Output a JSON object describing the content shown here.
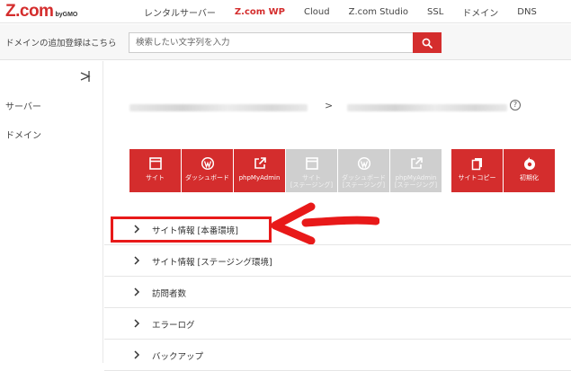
{
  "brand": {
    "logo_main": "Z.com",
    "logo_sub": "byGMO"
  },
  "nav": {
    "items": [
      {
        "label": "レンタルサーバー",
        "active": false
      },
      {
        "label": "Z.com WP",
        "active": true
      },
      {
        "label": "Cloud",
        "active": false
      },
      {
        "label": "Z.com Studio",
        "active": false
      },
      {
        "label": "SSL",
        "active": false
      },
      {
        "label": "ドメイン",
        "active": false
      },
      {
        "label": "DNS",
        "active": false
      }
    ]
  },
  "search": {
    "label": "ドメインの追加登録はこちら",
    "placeholder": "検索したい文字列を入力",
    "value": "",
    "button_icon": "search-icon"
  },
  "sidebar": {
    "collapse_icon": "collapse-icon",
    "items": [
      {
        "label": "サーバー"
      },
      {
        "label": "ドメイン"
      }
    ]
  },
  "breadcrumb": {
    "separator": ">",
    "help": "?"
  },
  "toolbar": {
    "buttons": [
      {
        "label": "サイト",
        "icon": "window-icon",
        "style": "red"
      },
      {
        "label": "ダッシュボード",
        "icon": "wordpress-icon",
        "style": "red"
      },
      {
        "label": "phpMyAdmin",
        "icon": "external-link-icon",
        "style": "red"
      },
      {
        "label": "サイト\n[ステージング]",
        "icon": "window-icon",
        "style": "grey"
      },
      {
        "label": "ダッシュボード\n[ステージング]",
        "icon": "wordpress-icon",
        "style": "grey"
      },
      {
        "label": "phpMyAdmin\n[ステージング]",
        "icon": "external-link-icon",
        "style": "grey"
      },
      {
        "label": "サイトコピー",
        "icon": "copy-icon",
        "style": "red"
      },
      {
        "label": "初期化",
        "icon": "reset-icon",
        "style": "red"
      }
    ]
  },
  "sections": [
    {
      "label": "サイト情報 [本番環境]"
    },
    {
      "label": "サイト情報 [ステージング環境]"
    },
    {
      "label": "訪問者数"
    },
    {
      "label": "エラーログ"
    },
    {
      "label": "バックアップ"
    }
  ],
  "colors": {
    "accent": "#d42d2d",
    "highlight": "#e81919",
    "disabled": "#cfcfcf"
  }
}
